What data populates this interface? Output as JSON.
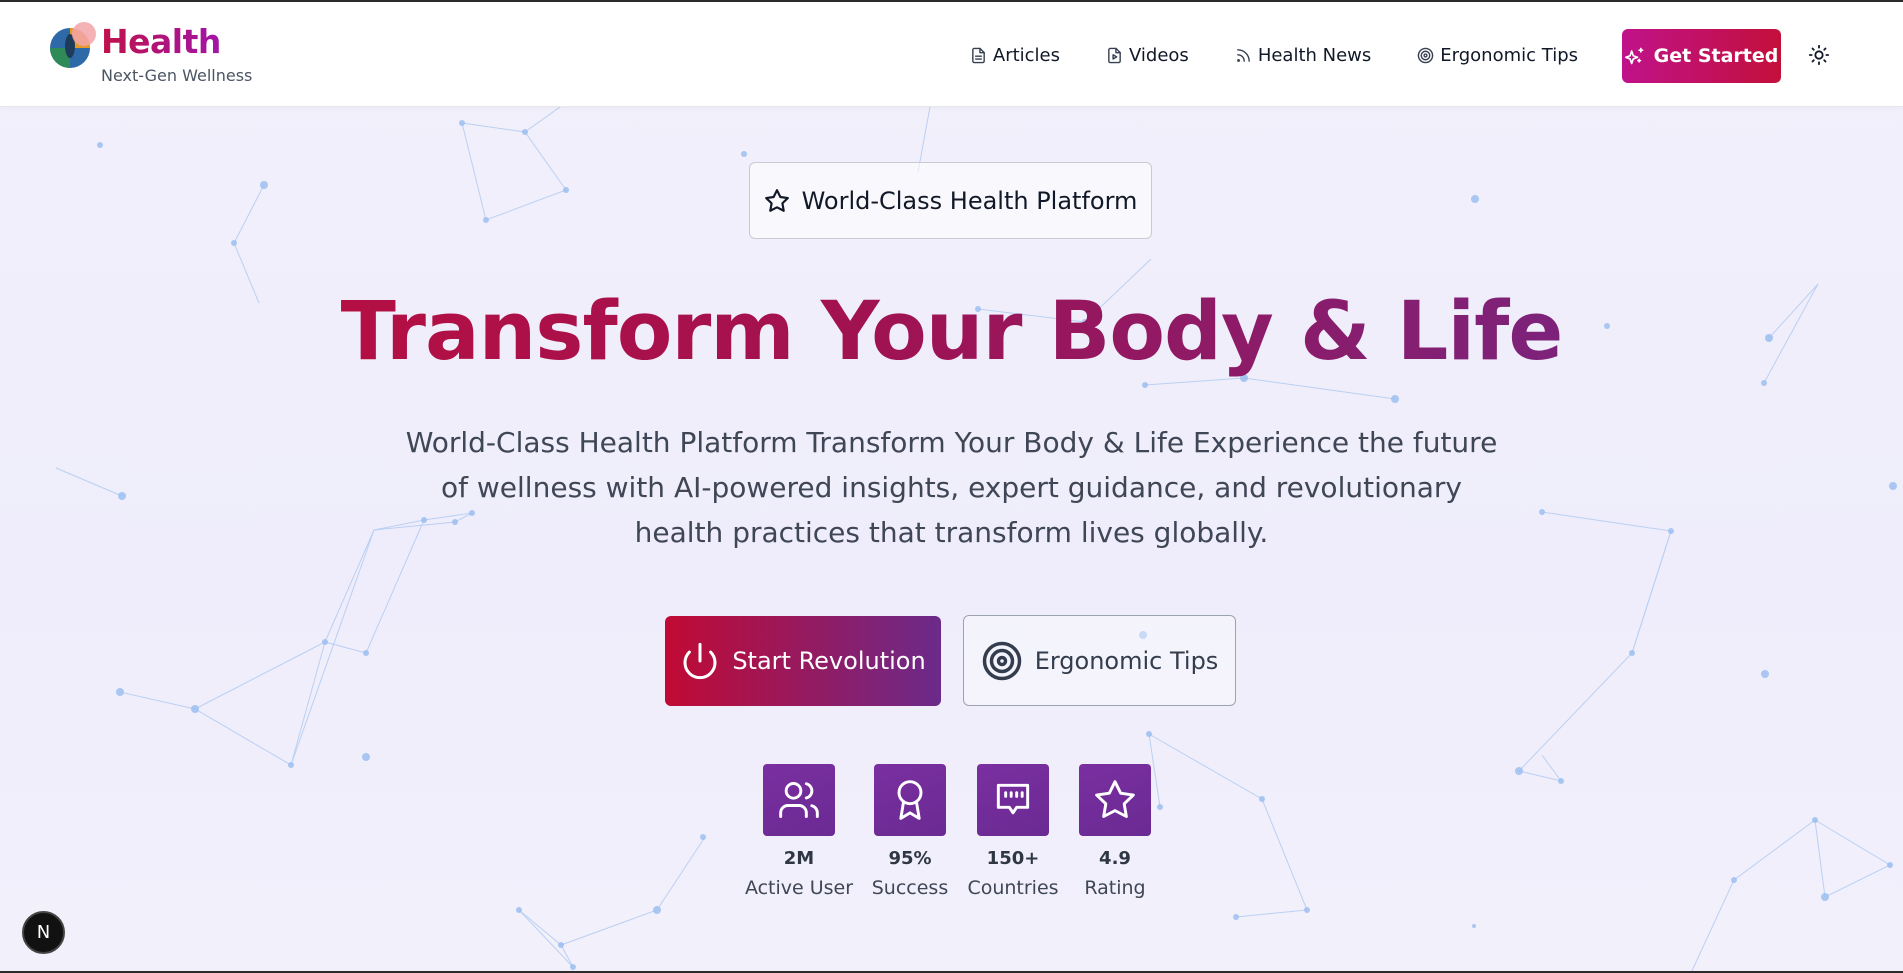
{
  "brand": {
    "name": "Health",
    "tagline": "Next-Gen Wellness"
  },
  "nav": {
    "items": [
      {
        "label": "Articles",
        "icon": "file-text-icon"
      },
      {
        "label": "Videos",
        "icon": "file-video-icon"
      },
      {
        "label": "Health News",
        "icon": "rss-icon"
      },
      {
        "label": "Ergonomic Tips",
        "icon": "target-icon"
      }
    ],
    "cta_label": "Get Started",
    "theme_toggle_icon": "sun-icon"
  },
  "hero": {
    "badge_label": "World-Class Health Platform",
    "title": "Transform Your Body & Life",
    "description": "World-Class Health Platform Transform Your Body & Life Experience the future of wellness with AI-powered insights, expert guidance, and revolutionary health practices that transform lives globally.",
    "primary_button": "Start Revolution",
    "secondary_button": "Ergonomic Tips"
  },
  "stats": [
    {
      "value": "2M",
      "label": "Active User",
      "icon": "users-icon"
    },
    {
      "value": "95%",
      "label": "Success",
      "icon": "award-icon"
    },
    {
      "value": "150+",
      "label": "Countries",
      "icon": "globe-network-icon"
    },
    {
      "value": "4.9",
      "label": "Rating",
      "icon": "star-icon"
    }
  ],
  "dev_badge": "N",
  "colors": {
    "brand_pink": "#c0124a",
    "brand_purple": "#6b2a8f",
    "background": "#efeefb",
    "stat_tile": "#7a2fa0"
  }
}
